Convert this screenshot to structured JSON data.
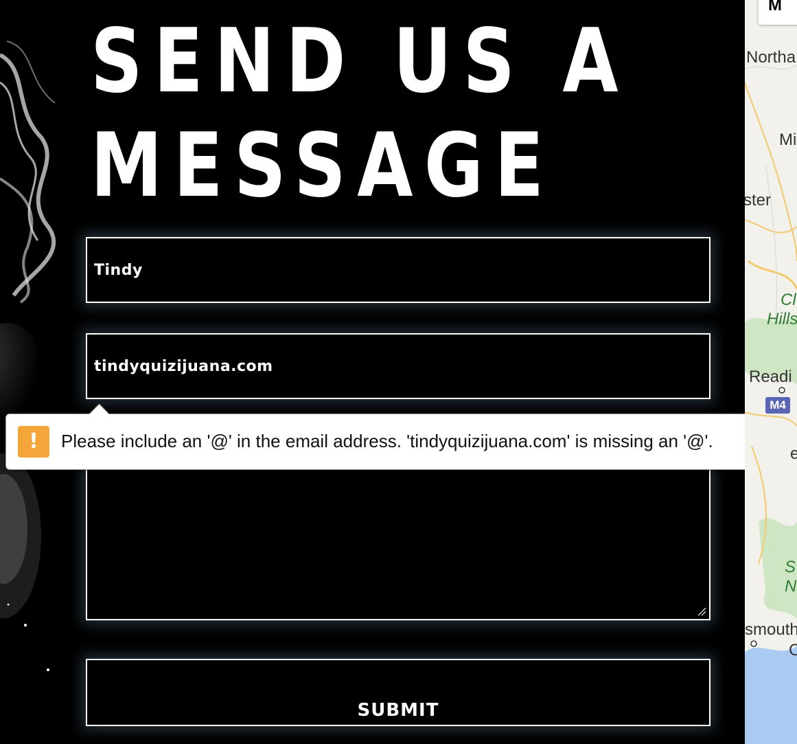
{
  "heading": {
    "line1": "SEND US A",
    "line2": "MESSAGE"
  },
  "form": {
    "name_value": "Tindy",
    "email_value": "tindyquizijuana.com",
    "message_value": "",
    "submit_label": "SUBMIT"
  },
  "validation": {
    "message": "Please include an '@' in the email address. 'tindyquizijuana.com' is missing an '@'.",
    "icon": "warning-icon",
    "icon_color": "#f4a63b"
  },
  "map": {
    "control_label": "M",
    "places": {
      "northampton": "Northa",
      "milton": "Mi",
      "ster": "ster",
      "chiltern_1": "Cl",
      "chiltern_2": "Hills",
      "reading": "Readi",
      "road_m4": "M4",
      "south_1": "S",
      "south_2": "N",
      "portsmouth": "smouth",
      "edge": "e",
      "coast": "C"
    }
  },
  "colors": {
    "background": "#000000",
    "foreground": "#ffffff",
    "glow": "#78a0c8"
  }
}
